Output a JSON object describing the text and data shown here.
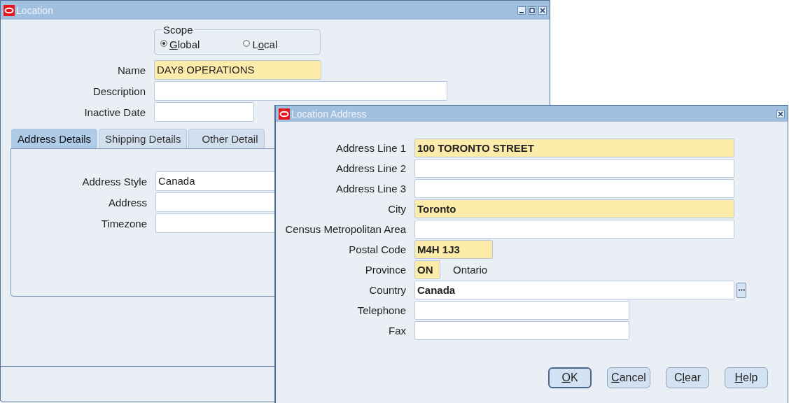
{
  "main_window": {
    "title": "Location",
    "scope": {
      "legend": "Scope",
      "options": [
        {
          "label": {
            "key": "G",
            "post": "lobal"
          },
          "selected": true
        },
        {
          "label": {
            "pre": "L",
            "key": "o",
            "post": "cal"
          },
          "selected": false
        }
      ]
    },
    "fields": [
      {
        "label": "Name",
        "value": "DAY8 OPERATIONS",
        "required": true
      },
      {
        "label": "Description",
        "required": false
      },
      {
        "label": "Inactive Date",
        "required": false
      }
    ],
    "tabs": [
      {
        "label": "Address Details",
        "selected": true
      },
      {
        "label": "Shipping Details",
        "selected": false
      },
      {
        "label": "Other Detail",
        "selected": false
      }
    ],
    "tab_fields": [
      {
        "label": "Address Style",
        "value": "Canada",
        "required": false
      },
      {
        "label": "Address",
        "required": false
      },
      {
        "label": "Timezone",
        "required": false
      }
    ]
  },
  "dialog": {
    "title": "Location Address",
    "fields": [
      {
        "label": "Address Line 1",
        "value": "100 TORONTO STREET",
        "required": true
      },
      {
        "label": "Address Line 2",
        "required": false
      },
      {
        "label": "Address Line 3",
        "required": false
      },
      {
        "label": "City",
        "value": "Toronto",
        "required": true
      },
      {
        "label": "Census Metropolitan Area",
        "required": false
      },
      {
        "label": "Postal Code",
        "value": "M4H 1J3",
        "required": true
      },
      {
        "label": "Province",
        "value": "ON",
        "required": true,
        "description": "Ontario"
      },
      {
        "label": "Country",
        "value": "Canada",
        "required": false,
        "list_button": true
      },
      {
        "label": "Telephone",
        "required": false
      },
      {
        "label": "Fax",
        "required": false
      }
    ],
    "buttons": [
      {
        "label": {
          "key": "O",
          "post": "K"
        },
        "default": true
      },
      {
        "label": {
          "key": "C",
          "post": "ancel"
        },
        "default": false
      },
      {
        "label": {
          "pre": "C",
          "key": "l",
          "post": "ear"
        },
        "default": false
      },
      {
        "label": {
          "key": "H",
          "post": "elp"
        },
        "default": false
      }
    ]
  }
}
